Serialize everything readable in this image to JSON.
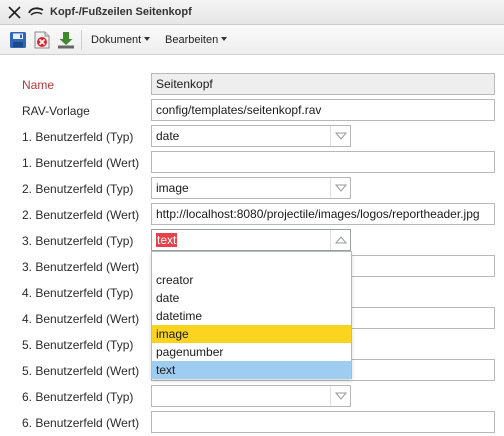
{
  "window": {
    "title": "Kopf-/Fußzeilen Seitenkopf"
  },
  "toolbar": {
    "buttons": [
      {
        "icon": "save-icon"
      },
      {
        "icon": "delete-icon"
      },
      {
        "icon": "download-icon"
      }
    ],
    "menus": [
      "Dokument",
      "Bearbeiten"
    ]
  },
  "form": {
    "name_label": "Name",
    "name_value": "Seitenkopf",
    "rav_label": "RAV-Vorlage",
    "rav_value": "config/templates/seitenkopf.rav",
    "field1_type_label": "1. Benutzerfeld (Typ)",
    "field1_type_value": "date",
    "field1_value_label": "1. Benutzerfeld (Wert)",
    "field1_value_value": "",
    "field2_type_label": "2. Benutzerfeld (Typ)",
    "field2_type_value": "image",
    "field2_value_label": "2. Benutzerfeld (Wert)",
    "field2_value_value": "http://localhost:8080/projectile/images/logos/reportheader.jpg",
    "field3_type_label": "3. Benutzerfeld (Typ)",
    "field3_type_value": "text",
    "field3_value_label": "3. Benutzerfeld (Wert)",
    "field4_type_label": "4. Benutzerfeld (Typ)",
    "field4_value_label": "4. Benutzerfeld (Wert)",
    "field5_type_label": "5. Benutzerfeld (Typ)",
    "field5_value_label": "5. Benutzerfeld (Wert)",
    "field6_type_label": "6. Benutzerfeld (Typ)",
    "field6_type_value": "",
    "field6_value_label": "6. Benutzerfeld (Wert)",
    "field6_value_value": ""
  },
  "dropdown": {
    "options": [
      "",
      "creator",
      "date",
      "datetime",
      "image",
      "pagenumber",
      "text"
    ],
    "hovered": "image",
    "selected": "text"
  },
  "colors": {
    "required_label": "#b23a3a",
    "hover": "#fbd41f",
    "selected": "#9fcdf2",
    "text_highlight": "#e8414b"
  }
}
